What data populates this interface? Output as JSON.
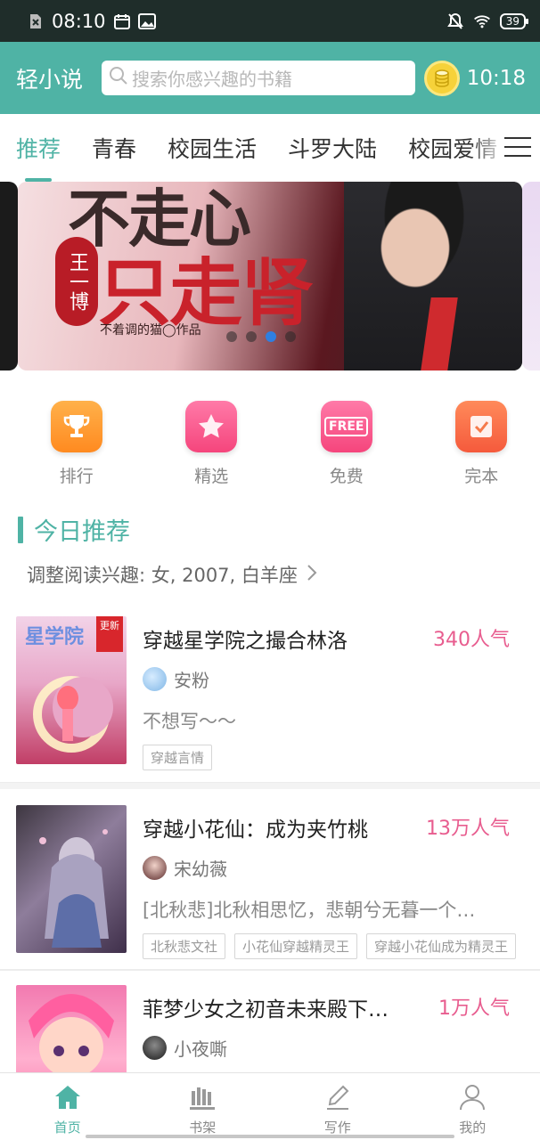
{
  "status_bar": {
    "time": "08:10",
    "battery": "39"
  },
  "header": {
    "app_title": "轻小说",
    "search_placeholder": "搜索你感兴趣的书籍",
    "clock": "10:18"
  },
  "tabs": [
    "推荐",
    "青春",
    "校园生活",
    "斗罗大陆",
    "校园爱情"
  ],
  "banner": {
    "headline_line1": "不走心",
    "headline_line2": "只走肾",
    "author_badge": "王一博",
    "byline": "不着调的猫◯作品",
    "active_dot": 2,
    "dots": 4
  },
  "quick_links": [
    {
      "label": "排行",
      "icon": "trophy-icon"
    },
    {
      "label": "精选",
      "icon": "star-icon"
    },
    {
      "label": "免费",
      "icon": "free-icon",
      "icon_text": "FREE"
    },
    {
      "label": "完本",
      "icon": "check-icon"
    }
  ],
  "section": {
    "title": "今日推荐",
    "interest": "调整阅读兴趣: 女, 2007, 白羊座"
  },
  "books": [
    {
      "title": "穿越星学院之撮合林洛",
      "popularity": "340人气",
      "author": "安粉",
      "desc": "不想写～～",
      "tags": [
        "穿越言情"
      ],
      "badge": "更新"
    },
    {
      "title": "穿越小花仙：成为夹竹桃",
      "popularity": "13万人气",
      "author": "宋幼薇",
      "desc": "[北秋悲]北秋相思忆，悲朝兮无暮一个…",
      "tags": [
        "北秋悲文社",
        "小花仙穿越精灵王",
        "穿越小花仙成为精灵王"
      ]
    },
    {
      "title": "菲梦少女之初音未来殿下…",
      "popularity": "1万人气",
      "author": "小夜嘶",
      "desc": "",
      "tags": []
    }
  ],
  "bottom_nav": [
    {
      "label": "首页",
      "icon": "home-icon",
      "active": true
    },
    {
      "label": "书架",
      "icon": "bookshelf-icon",
      "active": false
    },
    {
      "label": "写作",
      "icon": "pen-icon",
      "active": false
    },
    {
      "label": "我的",
      "icon": "user-icon",
      "active": false
    }
  ],
  "colors": {
    "accent": "#4fb3a5",
    "popularity": "#e85d8f",
    "status_bar": "#1f2d2a"
  }
}
